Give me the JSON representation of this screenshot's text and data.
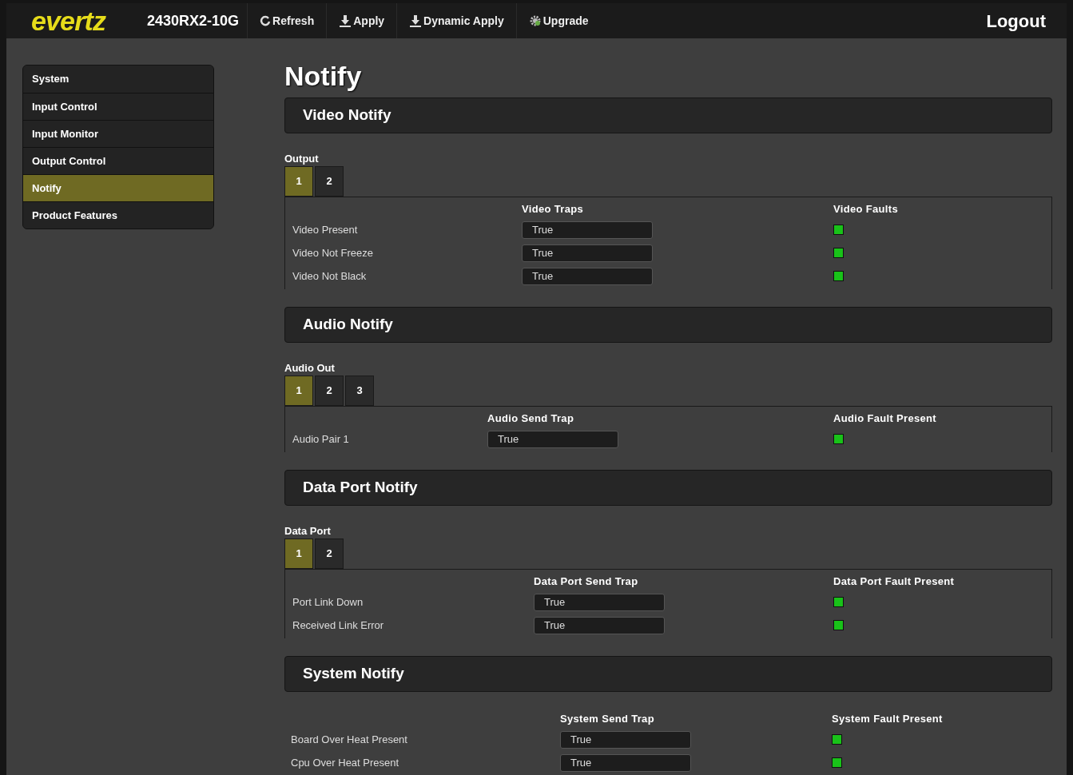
{
  "top_bar": {
    "logo": "evertz",
    "model": "2430RX2-10G",
    "buttons": [
      {
        "kind": "refresh",
        "label": "Refresh"
      },
      {
        "kind": "apply",
        "label": "Apply"
      },
      {
        "kind": "dynamic",
        "label": "Dynamic Apply"
      },
      {
        "kind": "upgrade",
        "label": "Upgrade"
      }
    ],
    "logout": "Logout"
  },
  "sidebar": {
    "items": [
      {
        "label": "System",
        "selected": false
      },
      {
        "label": "Input Control",
        "selected": false
      },
      {
        "label": "Input Monitor",
        "selected": false
      },
      {
        "label": "Output Control",
        "selected": false
      },
      {
        "label": "Notify",
        "selected": true
      },
      {
        "label": "Product Features",
        "selected": false
      }
    ]
  },
  "page_title": "Notify",
  "sections": [
    {
      "title": "Video Notify",
      "tab_label": "Output",
      "tabs": [
        {
          "label": "1",
          "selected": true
        },
        {
          "label": "2",
          "selected": false
        }
      ],
      "columns": [
        "Video Traps",
        "Video Faults"
      ],
      "rows": [
        {
          "label": "Video Present",
          "value": "True",
          "fault": false
        },
        {
          "label": "Video Not Freeze",
          "value": "True",
          "fault": false
        },
        {
          "label": "Video Not Black",
          "value": "True",
          "fault": false
        }
      ]
    },
    {
      "title": "Audio Notify",
      "tab_label": "Audio Out",
      "tabs": [
        {
          "label": "1",
          "selected": true
        },
        {
          "label": "2",
          "selected": false
        },
        {
          "label": "3",
          "selected": false
        }
      ],
      "columns": [
        "Audio Send Trap",
        "Audio Fault Present"
      ],
      "rows": [
        {
          "label": "Audio Pair 1",
          "value": "True",
          "fault": false
        }
      ]
    },
    {
      "title": "Data Port Notify",
      "tab_label": "Data Port",
      "tabs": [
        {
          "label": "1",
          "selected": true
        },
        {
          "label": "2",
          "selected": false
        }
      ],
      "columns": [
        "Data Port Send Trap",
        "Data Port Fault Present"
      ],
      "rows": [
        {
          "label": "Port Link Down",
          "value": "True",
          "fault": false
        },
        {
          "label": "Received Link Error",
          "value": "True",
          "fault": false
        }
      ]
    },
    {
      "title": "System Notify",
      "columns": [
        "System Send Trap",
        "System Fault Present"
      ],
      "rows": [
        {
          "label": "Board Over Heat Present",
          "value": "True",
          "fault": false
        },
        {
          "label": "Cpu Over Heat Present",
          "value": "True",
          "fault": false
        }
      ]
    }
  ]
}
